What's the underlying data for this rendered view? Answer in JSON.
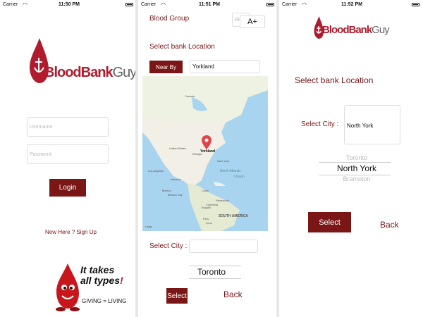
{
  "screens": {
    "login": {
      "status": {
        "carrier": "Carrier",
        "time": "11:50 PM"
      },
      "logo": {
        "word1": "BloodBank",
        "word2": "Guy"
      },
      "username_placeholder": "Username",
      "password_placeholder": "Password",
      "login_label": "Login",
      "signup_link": "New Here ? Sign Up",
      "promo": {
        "line1": "It takes",
        "line2": "all types",
        "exclaim": "!",
        "tagline": "GIVING = LIVING"
      }
    },
    "map_search": {
      "status": {
        "carrier": "Carrier",
        "time": "11:51 PM"
      },
      "blood_group_label": "Blood Group",
      "blood_group_input": "Blo...",
      "blood_group_value": "A+",
      "select_location_label": "Select bank Location",
      "nearby_label": "Near By",
      "location_value": "Yorkland",
      "map": {
        "pin_label": "Yorkland",
        "places": {
          "canada": "Canada",
          "united_states": "United States",
          "mexico": "Mexico",
          "los_angeles": "Los Angeles",
          "chicago": "Chicago",
          "new_york": "New York",
          "houston": "Houston",
          "mexico_city": "Mexico City",
          "cuba": "Cuba",
          "bogota": "Bogotá",
          "lima": "Lima",
          "colombia": "Colombia",
          "peru": "Peru",
          "venezuela": "Venezuela",
          "south_america": "SOUTH AMERICA",
          "north_atlantic": "North Atlantic",
          "ocean": "Ocean",
          "legal": "Legal"
        }
      },
      "select_city_label": "Select City :",
      "picker_value": "Toronto",
      "select_label": "Select",
      "back_label": "Back"
    },
    "city_select": {
      "status": {
        "carrier": "Carrier",
        "time": "11:52 PM"
      },
      "logo": {
        "word1": "BloodBank",
        "word2": "Guy"
      },
      "select_location_label": "Select bank Location",
      "select_city_label": "Select City :",
      "city_value": "North York",
      "picker_above": "Toronto",
      "picker_value": "North York",
      "picker_below": "Brampton",
      "select_label": "Select",
      "back_label": "Back"
    }
  },
  "colors": {
    "maroon": "#7b1616",
    "brand_red": "#b01c2e",
    "map_water": "#a8d4ef",
    "map_land": "#f1efe6"
  }
}
